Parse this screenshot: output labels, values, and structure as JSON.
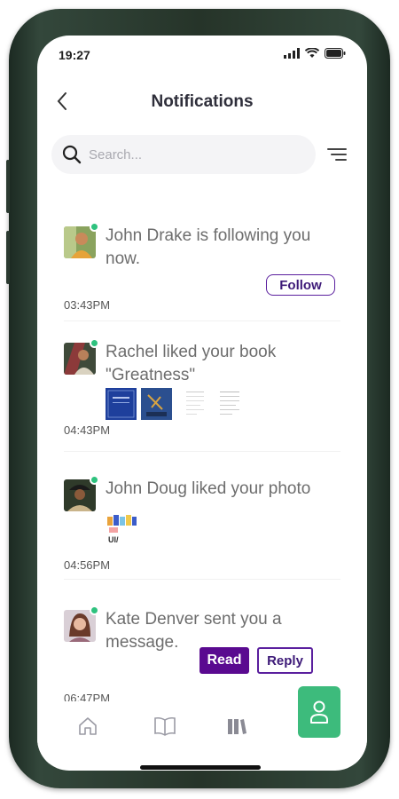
{
  "status_bar": {
    "time": "19:27"
  },
  "header": {
    "title": "Notifications"
  },
  "search": {
    "placeholder": "Search..."
  },
  "notifications": [
    {
      "text": "John Drake is following you now.",
      "time": "03:43PM",
      "action": "Follow"
    },
    {
      "text": "Rachel liked your book \"Greatness\"",
      "time": "04:43PM"
    },
    {
      "text": "John Doug liked your photo",
      "time": "04:56PM",
      "photo_caption": "UI/"
    },
    {
      "text": "Kate Denver sent you a message.",
      "time": "06:47PM",
      "actions": [
        "Read",
        "Reply"
      ]
    }
  ],
  "tab_bar": {
    "tabs": [
      "home-icon",
      "book-icon",
      "library-icon"
    ],
    "fab_icon": "profile-icon"
  },
  "colors": {
    "accent": "#5a0a90",
    "online": "#2ec27e",
    "fab": "#3dbb7c",
    "bezel": "#263429"
  }
}
